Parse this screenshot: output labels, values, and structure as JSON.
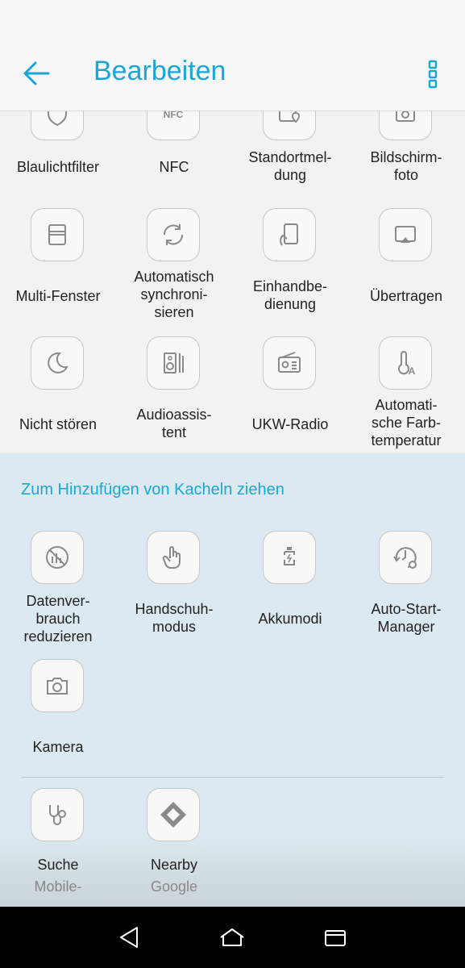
{
  "header": {
    "title": "Bearbeiten"
  },
  "active_tiles": [
    {
      "label": "Blaulichtfilter",
      "icon": "shield-icon"
    },
    {
      "label": "NFC",
      "icon": "nfc-icon",
      "icon_text": "NFC"
    },
    {
      "label": "Standortmel-\ndung",
      "icon": "location-icon"
    },
    {
      "label": "Bildschirm-\nfoto",
      "icon": "screenshot-icon"
    },
    {
      "label": "Multi-Fenster",
      "icon": "multi-window-icon"
    },
    {
      "label": "Automatisch\nsynchroni-\nsieren",
      "icon": "sync-icon"
    },
    {
      "label": "Einhandbe-\ndienung",
      "icon": "one-hand-icon"
    },
    {
      "label": "Übertragen",
      "icon": "cast-icon"
    },
    {
      "label": "Nicht stören",
      "icon": "moon-icon"
    },
    {
      "label": "Audioassis-\ntent",
      "icon": "audio-wizard-icon"
    },
    {
      "label": "UKW-Radio",
      "icon": "radio-icon"
    },
    {
      "label": "Automati-\nsche Farb-\ntemperatur",
      "icon": "thermometer-icon"
    }
  ],
  "add_section": {
    "header": "Zum Hinzufügen von Kacheln ziehen",
    "tiles": [
      {
        "label": "Datenver-\nbrauch\nreduzieren",
        "icon": "data-saver-icon"
      },
      {
        "label": "Handschuh-\nmodus",
        "icon": "glove-icon"
      },
      {
        "label": "Akkumodi",
        "icon": "battery-icon"
      },
      {
        "label": "Auto-Start-\nManager",
        "icon": "auto-start-icon"
      },
      {
        "label": "Kamera",
        "icon": "camera-icon"
      }
    ],
    "app_tiles": [
      {
        "label": "Suche",
        "sublabel": "Mobile-",
        "icon": "stethoscope-icon"
      },
      {
        "label": "Nearby",
        "sublabel": "Google",
        "icon": "nearby-icon"
      }
    ]
  },
  "colors": {
    "accent": "#1aa7d8",
    "icon_stroke": "#8a8a8a",
    "add_bg": "#dde9f0"
  }
}
